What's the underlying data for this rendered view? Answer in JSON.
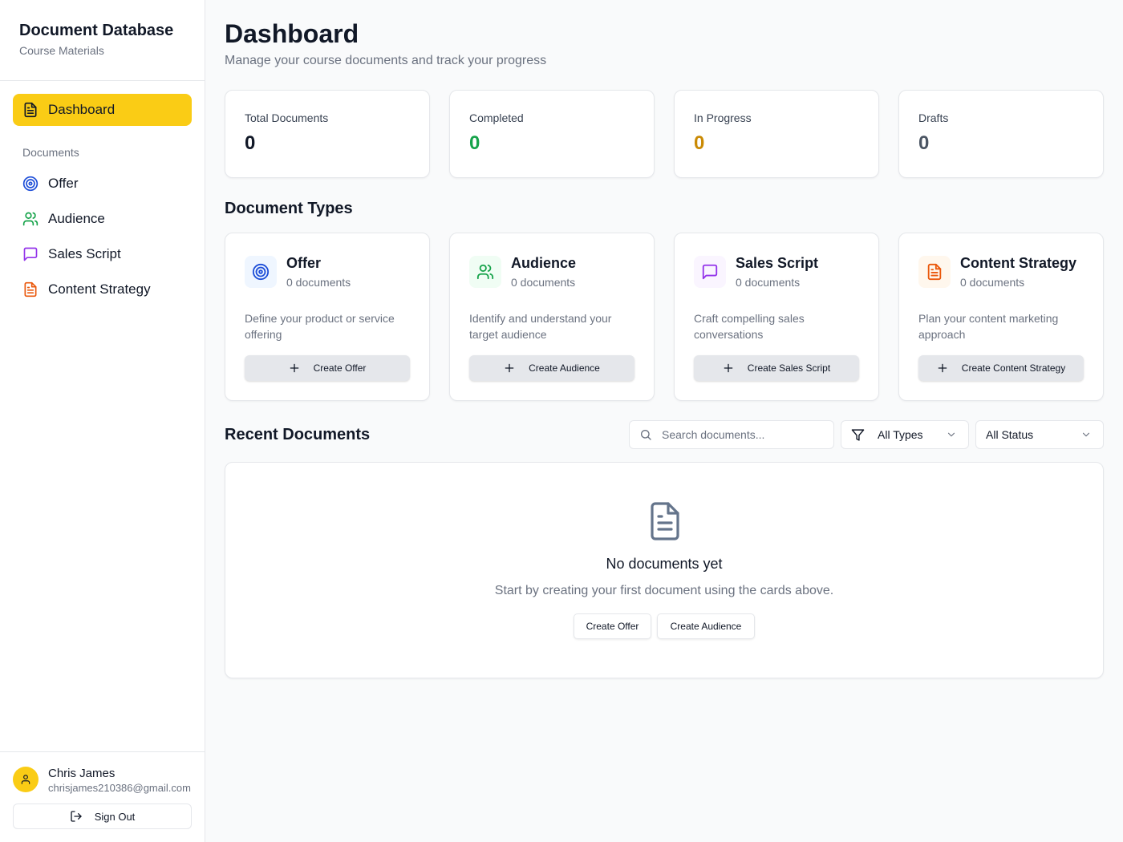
{
  "sidebar": {
    "title": "Document Database",
    "subtitle": "Course Materials",
    "active_item": "Dashboard",
    "section_label": "Documents",
    "items": [
      {
        "label": "Offer",
        "icon": "target-icon",
        "color": "#1d4ed8"
      },
      {
        "label": "Audience",
        "icon": "users-icon",
        "color": "#16a34a"
      },
      {
        "label": "Sales Script",
        "icon": "message-square-icon",
        "color": "#9333ea"
      },
      {
        "label": "Content Strategy",
        "icon": "file-text-icon",
        "color": "#ea580c"
      }
    ],
    "user": {
      "name": "Chris James",
      "email": "chrisjames210386@gmail.com"
    },
    "sign_out": "Sign Out"
  },
  "header": {
    "title": "Dashboard",
    "subtitle": "Manage your course documents and track your progress"
  },
  "stats": [
    {
      "label": "Total Documents",
      "value": "0",
      "color": "#111827"
    },
    {
      "label": "Completed",
      "value": "0",
      "color": "#16a34a"
    },
    {
      "label": "In Progress",
      "value": "0",
      "color": "#ca8a04"
    },
    {
      "label": "Drafts",
      "value": "0",
      "color": "#4b5563"
    }
  ],
  "document_types": {
    "title": "Document Types",
    "cards": [
      {
        "name": "Offer",
        "count": "0 documents",
        "description": "Define your product or service offering",
        "button": "Create Offer",
        "icon": "target-icon",
        "color": "#1d4ed8",
        "bg": "#eff6ff"
      },
      {
        "name": "Audience",
        "count": "0 documents",
        "description": "Identify and understand your target audience",
        "button": "Create Audience",
        "icon": "users-icon",
        "color": "#16a34a",
        "bg": "#f0fdf4"
      },
      {
        "name": "Sales Script",
        "count": "0 documents",
        "description": "Craft compelling sales conversations",
        "button": "Create Sales Script",
        "icon": "message-square-icon",
        "color": "#9333ea",
        "bg": "#faf5ff"
      },
      {
        "name": "Content Strategy",
        "count": "0 documents",
        "description": "Plan your content marketing approach",
        "button": "Create Content Strategy",
        "icon": "file-text-icon",
        "color": "#ea580c",
        "bg": "#fff7ed"
      }
    ]
  },
  "recent": {
    "title": "Recent Documents",
    "search_placeholder": "Search documents...",
    "type_filter": "All Types",
    "status_filter": "All Status",
    "empty_title": "No documents yet",
    "empty_subtitle": "Start by creating your first document using the cards above.",
    "empty_buttons": [
      "Create Offer",
      "Create Audience"
    ]
  }
}
